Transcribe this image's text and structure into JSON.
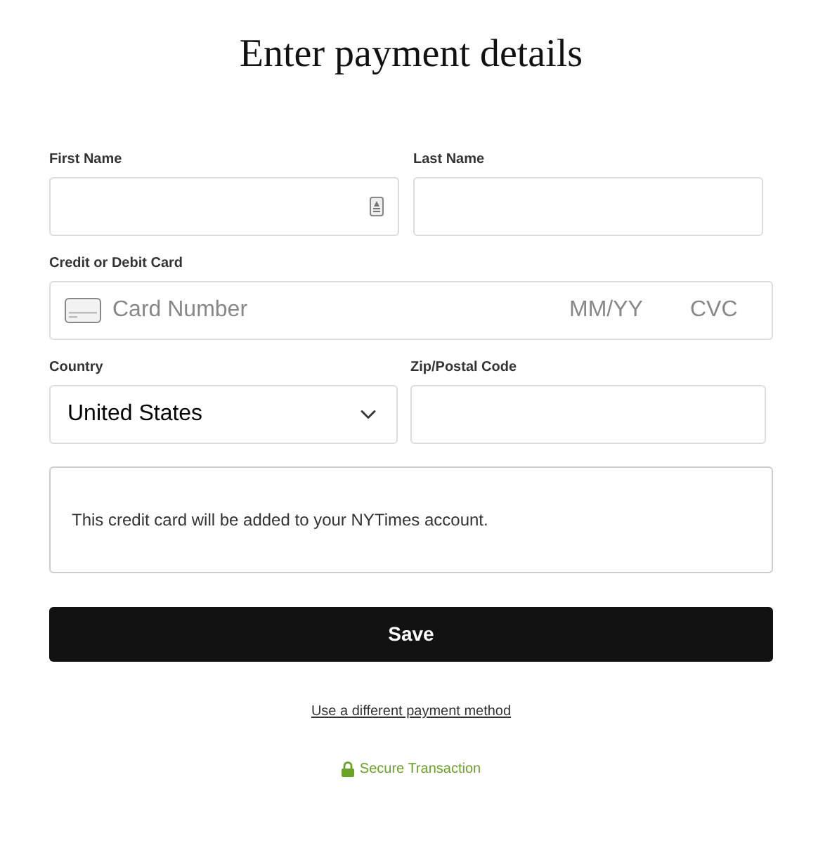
{
  "title": "Enter payment details",
  "fields": [
    {
      "label": "First Name",
      "autofill_icon": true
    },
    {
      "label": "Last Name"
    }
  ],
  "card": {
    "label": "Credit or Debit Card",
    "number_placeholder": "Card Number",
    "expiry_placeholder": "MM/YY",
    "cvc_placeholder": "CVC"
  },
  "country": {
    "label": "Country",
    "value": "United States"
  },
  "zip": {
    "label": "Zip/Postal Code"
  },
  "notice": "This credit card will be added to your NYTimes account.",
  "save_button": "Save",
  "alt_link": "Use a different payment method",
  "secure": "Secure Transaction"
}
